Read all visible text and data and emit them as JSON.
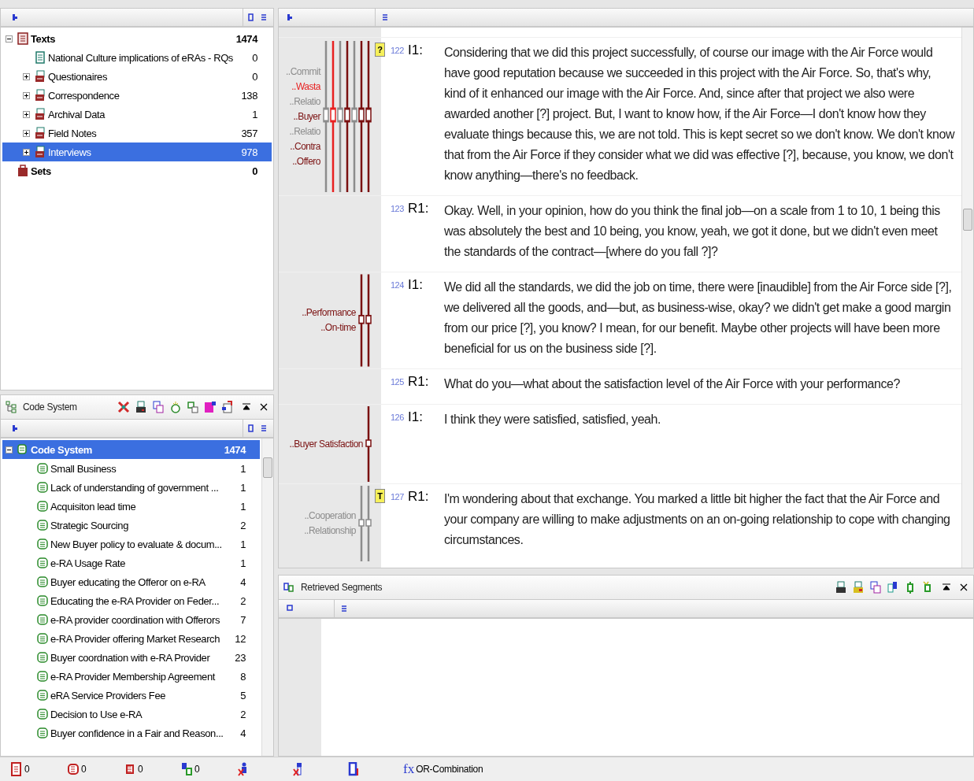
{
  "document_system": {
    "items": [
      {
        "kind": "root",
        "label": "Texts",
        "count": "1474",
        "expanded": true,
        "selected": false
      },
      {
        "kind": "document",
        "label": "National Culture implications of eRAs - RQs",
        "count": "0",
        "selected": false
      },
      {
        "kind": "group",
        "label": "Questionaires",
        "count": "0",
        "expanded": false,
        "selected": false
      },
      {
        "kind": "group",
        "label": "Correspondence",
        "count": "138",
        "expanded": false,
        "selected": false
      },
      {
        "kind": "group",
        "label": "Archival Data",
        "count": "1",
        "expanded": false,
        "selected": false
      },
      {
        "kind": "group",
        "label": "Field Notes",
        "count": "357",
        "expanded": false,
        "selected": false
      },
      {
        "kind": "group",
        "label": "Interviews",
        "count": "978",
        "expanded": false,
        "selected": true
      },
      {
        "kind": "set",
        "label": "Sets",
        "count": "0",
        "selected": false
      }
    ]
  },
  "code_system": {
    "title": "Code System",
    "root": {
      "label": "Code System",
      "count": "1474",
      "expanded": true,
      "selected": true
    },
    "codes": [
      {
        "label": "Small Business",
        "count": "1"
      },
      {
        "label": "Lack of understanding of government ...",
        "count": "1"
      },
      {
        "label": "Acquisiton lead time",
        "count": "1"
      },
      {
        "label": "Strategic Sourcing",
        "count": "2"
      },
      {
        "label": "New Buyer policy to evaluate & docum...",
        "count": "1"
      },
      {
        "label": "e-RA Usage Rate",
        "count": "1"
      },
      {
        "label": "Buyer educating the Offeror on e-RA",
        "count": "4"
      },
      {
        "label": "Educating the e-RA Provider on Feder...",
        "count": "2"
      },
      {
        "label": "e-RA provider coordination with Offerors",
        "count": "7"
      },
      {
        "label": "e-RA Provider offering Market Research",
        "count": "12"
      },
      {
        "label": "Buyer coordnation with e-RA Provider",
        "count": "23"
      },
      {
        "label": "e-RA Provider Membership Agreement",
        "count": "8"
      },
      {
        "label": "eRA Service Providers Fee",
        "count": "5"
      },
      {
        "label": "Decision to Use e-RA",
        "count": "2"
      },
      {
        "label": "Buyer confidence in a Fair and Reason...",
        "count": "4"
      }
    ]
  },
  "document_browser": {
    "paragraphs": [
      {
        "number": "122",
        "speaker": "I1:",
        "memo": "?",
        "text": "Considering that we did this project successfully, of course our image with the Air Force would have good reputation because we succeeded in this project with the Air Force. So, that's why, kind of it enhanced our image with the Air Force. And, since after that project we also were awarded another [?] project. But, I want to know how, if the Air Force—I don't know how they evaluate things because this, we are not told. This is kept secret so we don't know. We don't know that from the Air Force if they consider what we did was effective [?], because, you know, we don't know anything—there's no feedback.",
        "codes": [
          {
            "label": "..Commit",
            "color": "#8c8c8c"
          },
          {
            "label": "..Wasta",
            "color": "#e82020"
          },
          {
            "label": "..Relatio",
            "color": "#8c8c8c"
          },
          {
            "label": "..Buyer",
            "color": "#7a1010"
          },
          {
            "label": "..Relatio",
            "color": "#8c8c8c"
          },
          {
            "label": "..Contra",
            "color": "#7a1010"
          },
          {
            "label": "..Offero",
            "color": "#7a1010"
          }
        ]
      },
      {
        "number": "123",
        "speaker": "R1:",
        "text": "Okay. Well, in your opinion, how do you think the final job—on a scale from 1 to 10, 1 being this was absolutely the best and 10 being, you know, yeah, we got it done, but we didn't even meet the standards of the contract—[where do you fall ?]?"
      },
      {
        "number": "124",
        "speaker": "I1:",
        "text": "We did all the standards, we did the job on time, there were [inaudible] from the Air Force side [?], we delivered all the goods, and—but, as business-wise, okay? we didn't get make a good margin from our price [?], you know? I mean, for our benefit. Maybe other projects will have been more beneficial for us on the business side [?].",
        "codes": [
          {
            "label": "..Performance",
            "color": "#7a1010"
          },
          {
            "label": "..On-time",
            "color": "#7a1010"
          }
        ]
      },
      {
        "number": "125",
        "speaker": "R1:",
        "text": "What do you—what about the satisfaction level of the Air Force with your performance?"
      },
      {
        "number": "126",
        "speaker": "I1:",
        "text": "I think they were satisfied, satisfied, yeah.",
        "codes": [
          {
            "label": "..Buyer Satisfaction",
            "color": "#7a1010"
          }
        ]
      },
      {
        "number": "127",
        "speaker": "R1:",
        "memo": "T",
        "text": "I'm wondering about that exchange. You marked a little bit higher the fact that the Air Force and your company are willing to make adjustments on an on-going relationship to cope with changing circumstances.",
        "codes": [
          {
            "label": "..Cooperation",
            "color": "#8c8c8c"
          },
          {
            "label": "..Relationship",
            "color": "#8c8c8c"
          }
        ]
      }
    ]
  },
  "retrieved_segments": {
    "title": "Retrieved Segments"
  },
  "status_bar": {
    "counts": [
      "0",
      "0",
      "0",
      "0"
    ],
    "function_icon": "fx",
    "function_label": "OR-Combination"
  }
}
